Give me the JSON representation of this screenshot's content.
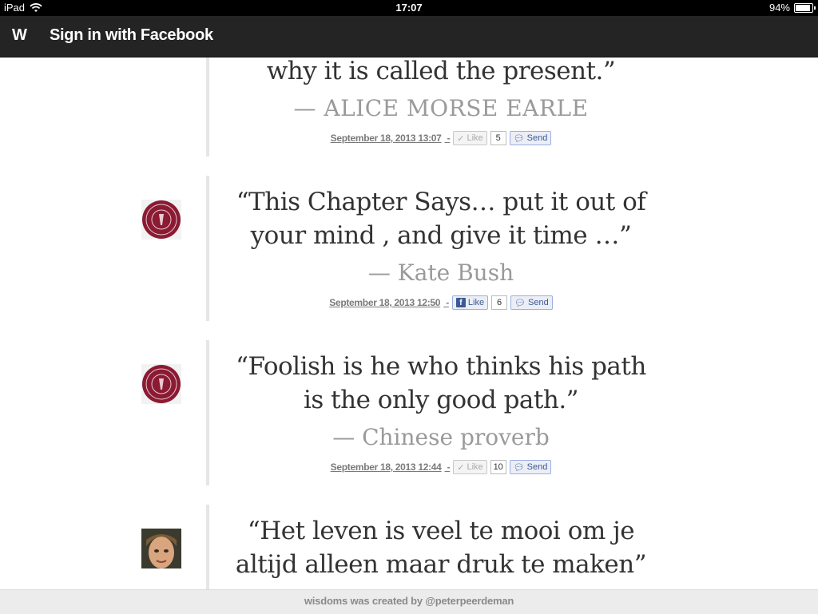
{
  "status_bar": {
    "device": "iPad",
    "time": "17:07",
    "battery": "94%"
  },
  "header": {
    "logo": "W",
    "signin_label": "Sign in with Facebook"
  },
  "entries": [
    {
      "quote": "why it is called the present.”",
      "author": "— ALICE MORSE EARLE",
      "date": "September 18, 2013 13:07",
      "like_label": "Like",
      "like_count": "5",
      "send_label": "Send"
    },
    {
      "quote_line1": "“This Chapter Says… put it out of",
      "quote_line2": "your mind , and give it time …”",
      "author": "— Kate Bush",
      "date": "September 18, 2013 12:50",
      "like_label": "Like",
      "like_count": "6",
      "send_label": "Send"
    },
    {
      "quote_line1": "“Foolish is he who thinks his path",
      "quote_line2": "is the only good path.”",
      "author": "— Chinese proverb",
      "date": "September 18, 2013 12:44",
      "like_label": "Like",
      "like_count": "10",
      "send_label": "Send"
    },
    {
      "quote_line1": "“Het leven is veel te mooi om je",
      "quote_line2": "altijd alleen maar druk te maken”"
    }
  ],
  "footer": {
    "text": "wisdoms was created by @peterpeerdeman"
  },
  "colors": {
    "header_bg": "#242424",
    "facebook_blue": "#3b5998",
    "seal_maroon": "#8b1a33"
  }
}
